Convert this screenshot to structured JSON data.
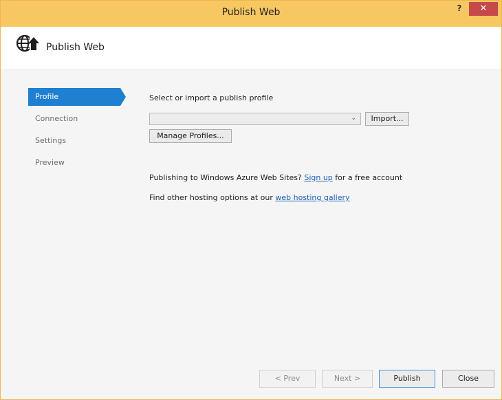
{
  "window": {
    "title": "Publish Web",
    "help_label": "?",
    "close_label": "✕"
  },
  "header": {
    "title": "Publish Web",
    "icon": "globe-arrow-icon"
  },
  "nav": {
    "items": [
      {
        "label": "Profile",
        "active": true
      },
      {
        "label": "Connection",
        "active": false
      },
      {
        "label": "Settings",
        "active": false
      },
      {
        "label": "Preview",
        "active": false
      }
    ]
  },
  "main": {
    "section_label": "Select or import a publish profile",
    "profile_select_value": "",
    "import_label": "Import...",
    "manage_label": "Manage Profiles...",
    "azure_prefix": "Publishing to Windows Azure Web Sites? ",
    "azure_link": "Sign up",
    "azure_suffix": " for a free account",
    "hosting_prefix": "Find other hosting options at our ",
    "hosting_link": "web hosting gallery"
  },
  "footer": {
    "prev_label": "< Prev",
    "next_label": "Next >",
    "publish_label": "Publish",
    "close_label": "Close"
  },
  "colors": {
    "titlebar": "#f7c762",
    "accent": "#1f7fd1",
    "close_button": "#c74848",
    "link": "#1a5fb4"
  }
}
